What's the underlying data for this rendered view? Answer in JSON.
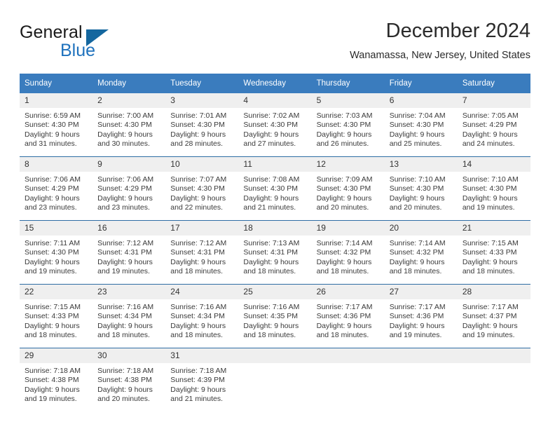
{
  "brand": {
    "word_one": "General",
    "word_two": "Blue",
    "logo_icon": "triangle-logo-icon",
    "accent_color": "#1f72bd",
    "triangle_color": "#15679f"
  },
  "header": {
    "title": "December 2024",
    "subtitle": "Wanamassa, New Jersey, United States"
  },
  "calendar": {
    "header_bg": "#3a7cbe",
    "row_divider_color": "#2e6da4",
    "daynum_bg": "#efefef",
    "weekday_headers": [
      "Sunday",
      "Monday",
      "Tuesday",
      "Wednesday",
      "Thursday",
      "Friday",
      "Saturday"
    ],
    "weeks": [
      [
        {
          "day": "1",
          "sunrise": "Sunrise: 6:59 AM",
          "sunset": "Sunset: 4:30 PM",
          "daylight_line1": "Daylight: 9 hours",
          "daylight_line2": "and 31 minutes."
        },
        {
          "day": "2",
          "sunrise": "Sunrise: 7:00 AM",
          "sunset": "Sunset: 4:30 PM",
          "daylight_line1": "Daylight: 9 hours",
          "daylight_line2": "and 30 minutes."
        },
        {
          "day": "3",
          "sunrise": "Sunrise: 7:01 AM",
          "sunset": "Sunset: 4:30 PM",
          "daylight_line1": "Daylight: 9 hours",
          "daylight_line2": "and 28 minutes."
        },
        {
          "day": "4",
          "sunrise": "Sunrise: 7:02 AM",
          "sunset": "Sunset: 4:30 PM",
          "daylight_line1": "Daylight: 9 hours",
          "daylight_line2": "and 27 minutes."
        },
        {
          "day": "5",
          "sunrise": "Sunrise: 7:03 AM",
          "sunset": "Sunset: 4:30 PM",
          "daylight_line1": "Daylight: 9 hours",
          "daylight_line2": "and 26 minutes."
        },
        {
          "day": "6",
          "sunrise": "Sunrise: 7:04 AM",
          "sunset": "Sunset: 4:30 PM",
          "daylight_line1": "Daylight: 9 hours",
          "daylight_line2": "and 25 minutes."
        },
        {
          "day": "7",
          "sunrise": "Sunrise: 7:05 AM",
          "sunset": "Sunset: 4:29 PM",
          "daylight_line1": "Daylight: 9 hours",
          "daylight_line2": "and 24 minutes."
        }
      ],
      [
        {
          "day": "8",
          "sunrise": "Sunrise: 7:06 AM",
          "sunset": "Sunset: 4:29 PM",
          "daylight_line1": "Daylight: 9 hours",
          "daylight_line2": "and 23 minutes."
        },
        {
          "day": "9",
          "sunrise": "Sunrise: 7:06 AM",
          "sunset": "Sunset: 4:29 PM",
          "daylight_line1": "Daylight: 9 hours",
          "daylight_line2": "and 23 minutes."
        },
        {
          "day": "10",
          "sunrise": "Sunrise: 7:07 AM",
          "sunset": "Sunset: 4:30 PM",
          "daylight_line1": "Daylight: 9 hours",
          "daylight_line2": "and 22 minutes."
        },
        {
          "day": "11",
          "sunrise": "Sunrise: 7:08 AM",
          "sunset": "Sunset: 4:30 PM",
          "daylight_line1": "Daylight: 9 hours",
          "daylight_line2": "and 21 minutes."
        },
        {
          "day": "12",
          "sunrise": "Sunrise: 7:09 AM",
          "sunset": "Sunset: 4:30 PM",
          "daylight_line1": "Daylight: 9 hours",
          "daylight_line2": "and 20 minutes."
        },
        {
          "day": "13",
          "sunrise": "Sunrise: 7:10 AM",
          "sunset": "Sunset: 4:30 PM",
          "daylight_line1": "Daylight: 9 hours",
          "daylight_line2": "and 20 minutes."
        },
        {
          "day": "14",
          "sunrise": "Sunrise: 7:10 AM",
          "sunset": "Sunset: 4:30 PM",
          "daylight_line1": "Daylight: 9 hours",
          "daylight_line2": "and 19 minutes."
        }
      ],
      [
        {
          "day": "15",
          "sunrise": "Sunrise: 7:11 AM",
          "sunset": "Sunset: 4:30 PM",
          "daylight_line1": "Daylight: 9 hours",
          "daylight_line2": "and 19 minutes."
        },
        {
          "day": "16",
          "sunrise": "Sunrise: 7:12 AM",
          "sunset": "Sunset: 4:31 PM",
          "daylight_line1": "Daylight: 9 hours",
          "daylight_line2": "and 19 minutes."
        },
        {
          "day": "17",
          "sunrise": "Sunrise: 7:12 AM",
          "sunset": "Sunset: 4:31 PM",
          "daylight_line1": "Daylight: 9 hours",
          "daylight_line2": "and 18 minutes."
        },
        {
          "day": "18",
          "sunrise": "Sunrise: 7:13 AM",
          "sunset": "Sunset: 4:31 PM",
          "daylight_line1": "Daylight: 9 hours",
          "daylight_line2": "and 18 minutes."
        },
        {
          "day": "19",
          "sunrise": "Sunrise: 7:14 AM",
          "sunset": "Sunset: 4:32 PM",
          "daylight_line1": "Daylight: 9 hours",
          "daylight_line2": "and 18 minutes."
        },
        {
          "day": "20",
          "sunrise": "Sunrise: 7:14 AM",
          "sunset": "Sunset: 4:32 PM",
          "daylight_line1": "Daylight: 9 hours",
          "daylight_line2": "and 18 minutes."
        },
        {
          "day": "21",
          "sunrise": "Sunrise: 7:15 AM",
          "sunset": "Sunset: 4:33 PM",
          "daylight_line1": "Daylight: 9 hours",
          "daylight_line2": "and 18 minutes."
        }
      ],
      [
        {
          "day": "22",
          "sunrise": "Sunrise: 7:15 AM",
          "sunset": "Sunset: 4:33 PM",
          "daylight_line1": "Daylight: 9 hours",
          "daylight_line2": "and 18 minutes."
        },
        {
          "day": "23",
          "sunrise": "Sunrise: 7:16 AM",
          "sunset": "Sunset: 4:34 PM",
          "daylight_line1": "Daylight: 9 hours",
          "daylight_line2": "and 18 minutes."
        },
        {
          "day": "24",
          "sunrise": "Sunrise: 7:16 AM",
          "sunset": "Sunset: 4:34 PM",
          "daylight_line1": "Daylight: 9 hours",
          "daylight_line2": "and 18 minutes."
        },
        {
          "day": "25",
          "sunrise": "Sunrise: 7:16 AM",
          "sunset": "Sunset: 4:35 PM",
          "daylight_line1": "Daylight: 9 hours",
          "daylight_line2": "and 18 minutes."
        },
        {
          "day": "26",
          "sunrise": "Sunrise: 7:17 AM",
          "sunset": "Sunset: 4:36 PM",
          "daylight_line1": "Daylight: 9 hours",
          "daylight_line2": "and 18 minutes."
        },
        {
          "day": "27",
          "sunrise": "Sunrise: 7:17 AM",
          "sunset": "Sunset: 4:36 PM",
          "daylight_line1": "Daylight: 9 hours",
          "daylight_line2": "and 19 minutes."
        },
        {
          "day": "28",
          "sunrise": "Sunrise: 7:17 AM",
          "sunset": "Sunset: 4:37 PM",
          "daylight_line1": "Daylight: 9 hours",
          "daylight_line2": "and 19 minutes."
        }
      ],
      [
        {
          "day": "29",
          "sunrise": "Sunrise: 7:18 AM",
          "sunset": "Sunset: 4:38 PM",
          "daylight_line1": "Daylight: 9 hours",
          "daylight_line2": "and 19 minutes."
        },
        {
          "day": "30",
          "sunrise": "Sunrise: 7:18 AM",
          "sunset": "Sunset: 4:38 PM",
          "daylight_line1": "Daylight: 9 hours",
          "daylight_line2": "and 20 minutes."
        },
        {
          "day": "31",
          "sunrise": "Sunrise: 7:18 AM",
          "sunset": "Sunset: 4:39 PM",
          "daylight_line1": "Daylight: 9 hours",
          "daylight_line2": "and 21 minutes."
        },
        {
          "day": "",
          "sunrise": "",
          "sunset": "",
          "daylight_line1": "",
          "daylight_line2": ""
        },
        {
          "day": "",
          "sunrise": "",
          "sunset": "",
          "daylight_line1": "",
          "daylight_line2": ""
        },
        {
          "day": "",
          "sunrise": "",
          "sunset": "",
          "daylight_line1": "",
          "daylight_line2": ""
        },
        {
          "day": "",
          "sunrise": "",
          "sunset": "",
          "daylight_line1": "",
          "daylight_line2": ""
        }
      ]
    ]
  }
}
